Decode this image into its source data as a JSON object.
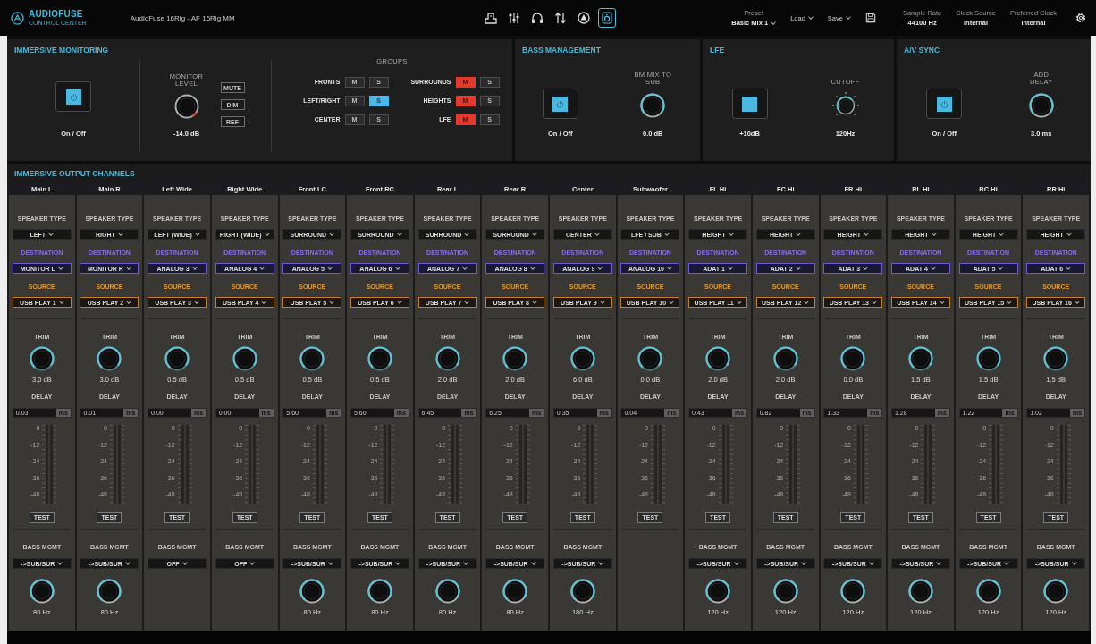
{
  "top_bar": {
    "logo": {
      "name": "AUDIOFUSE",
      "subtitle": "CONTROL CENTER"
    },
    "device": "AudioFuse 16Rig - AF 16Rig MM",
    "view_tabs": [
      {
        "kind": "device",
        "selected": false
      },
      {
        "kind": "mixer",
        "selected": false
      },
      {
        "kind": "headphones",
        "selected": false
      },
      {
        "kind": "routing",
        "selected": false
      },
      {
        "kind": "immersive",
        "selected": false
      },
      {
        "kind": "speaker",
        "selected": true
      }
    ],
    "preset": {
      "label": "Preset",
      "value": "Basic Mix 1"
    },
    "load": "Load",
    "save": "Save",
    "sample_rate": {
      "label": "Sample Rate",
      "value": "44100 Hz"
    },
    "clock_source": {
      "label": "Clock Source",
      "value": "Internal"
    },
    "preferred_clock": {
      "label": "Preferred Clock",
      "value": "Internal"
    }
  },
  "immersive_monitoring": {
    "title": "IMMERSIVE MONITORING",
    "power": {
      "label": "On / Off",
      "on": true
    },
    "monitor_level": {
      "label": "MONITOR LEVEL",
      "value": "-14.0 dB"
    },
    "buttons": [
      {
        "label": "MUTE",
        "on": false
      },
      {
        "label": "DIM",
        "on": false
      },
      {
        "label": "REF",
        "on": false
      }
    ],
    "groups": {
      "title": "GROUPS",
      "items": [
        {
          "label": "FRONTS",
          "buttons": [
            {
              "kind": "mute",
              "label": "M",
              "on": false
            },
            {
              "kind": "solo",
              "label": "S",
              "on": false
            }
          ]
        },
        {
          "label": "SURROUNDS",
          "buttons": [
            {
              "kind": "mute",
              "label": "M",
              "on": true
            },
            {
              "kind": "solo",
              "label": "S",
              "on": false
            }
          ]
        },
        {
          "label": "LEFT/RIGHT",
          "buttons": [
            {
              "kind": "mute",
              "label": "M",
              "on": false
            },
            {
              "kind": "solo",
              "label": "S",
              "on": true
            }
          ]
        },
        {
          "label": "HEIGHTS",
          "buttons": [
            {
              "kind": "mute",
              "label": "M",
              "on": true
            },
            {
              "kind": "solo",
              "label": "S",
              "on": false
            }
          ]
        },
        {
          "label": "CENTER",
          "buttons": [
            {
              "kind": "mute",
              "label": "M",
              "on": false
            },
            {
              "kind": "solo",
              "label": "S",
              "on": false
            }
          ]
        },
        {
          "label": "LFE",
          "buttons": [
            {
              "kind": "mute",
              "label": "M",
              "on": true
            },
            {
              "kind": "solo",
              "label": "S",
              "on": false
            }
          ]
        }
      ]
    }
  },
  "bass_management": {
    "title": "BASS MANAGEMENT",
    "power": {
      "label": "On / Off",
      "on": true
    },
    "mix_to_sub": {
      "label": "BM MIX TO SUB",
      "value": "0.0 dB"
    }
  },
  "lfe": {
    "title": "LFE",
    "boost": {
      "label": "+10dB",
      "on": true
    },
    "cutoff": {
      "label": "CUTOFF",
      "value": "120Hz"
    }
  },
  "av_sync": {
    "title": "A/V SYNC",
    "power": {
      "label": "On / Off",
      "on": true
    },
    "add_delay": {
      "label": "ADD DELAY",
      "value": "3.0 ms"
    }
  },
  "output_channels": {
    "title": "IMMERSIVE OUTPUT CHANNELS",
    "channels": [
      {
        "name": "Main L",
        "speaker_type": {
          "label": "SPEAKER TYPE",
          "value": "LEFT"
        },
        "destination": {
          "label": "DESTINATION",
          "value": "MONITOR L"
        },
        "source": {
          "label": "SOURCE",
          "value": "USB PLAY 1"
        },
        "trim": {
          "label": "TRIM",
          "value": "3.0 dB"
        },
        "delay": {
          "label": "DELAY",
          "value": "0.03",
          "unit": "ms"
        },
        "meter_scale": [
          "0",
          "-12",
          "-24",
          "-36",
          "-48"
        ],
        "test": "TEST",
        "bass_mgmt": {
          "label": "BASS MGMT",
          "value": "->SUB/SUR",
          "crossover": "80 Hz"
        }
      },
      {
        "name": "Main R",
        "speaker_type": {
          "label": "SPEAKER TYPE",
          "value": "RIGHT"
        },
        "destination": {
          "label": "DESTINATION",
          "value": "MONITOR R"
        },
        "source": {
          "label": "SOURCE",
          "value": "USB PLAY 2"
        },
        "trim": {
          "label": "TRIM",
          "value": "3.0 dB"
        },
        "delay": {
          "label": "DELAY",
          "value": "0.01",
          "unit": "ms"
        },
        "meter_scale": [
          "0",
          "-12",
          "-24",
          "-36",
          "-48"
        ],
        "test": "TEST",
        "bass_mgmt": {
          "label": "BASS MGMT",
          "value": "->SUB/SUR",
          "crossover": "80 Hz"
        }
      },
      {
        "name": "Left Wide",
        "speaker_type": {
          "label": "SPEAKER TYPE",
          "value": "LEFT (WIDE)"
        },
        "destination": {
          "label": "DESTINATION",
          "value": "ANALOG 3"
        },
        "source": {
          "label": "SOURCE",
          "value": "USB PLAY 3"
        },
        "trim": {
          "label": "TRIM",
          "value": "0.5 dB"
        },
        "delay": {
          "label": "DELAY",
          "value": "0.00",
          "unit": "ms"
        },
        "meter_scale": [
          "0",
          "-12",
          "-24",
          "-36",
          "-48"
        ],
        "test": "TEST",
        "bass_mgmt": {
          "label": "BASS MGMT",
          "value": "OFF"
        }
      },
      {
        "name": "Right Wide",
        "speaker_type": {
          "label": "SPEAKER TYPE",
          "value": "RIGHT (WIDE)"
        },
        "destination": {
          "label": "DESTINATION",
          "value": "ANALOG 4"
        },
        "source": {
          "label": "SOURCE",
          "value": "USB PLAY 4"
        },
        "trim": {
          "label": "TRIM",
          "value": "0.5 dB"
        },
        "delay": {
          "label": "DELAY",
          "value": "0.00",
          "unit": "ms"
        },
        "meter_scale": [
          "0",
          "-12",
          "-24",
          "-36",
          "-48"
        ],
        "test": "TEST",
        "bass_mgmt": {
          "label": "BASS MGMT",
          "value": "OFF"
        }
      },
      {
        "name": "Front LC",
        "speaker_type": {
          "label": "SPEAKER TYPE",
          "value": "SURROUND"
        },
        "destination": {
          "label": "DESTINATION",
          "value": "ANALOG 5"
        },
        "source": {
          "label": "SOURCE",
          "value": "USB PLAY 5"
        },
        "trim": {
          "label": "TRIM",
          "value": "0.5 dB"
        },
        "delay": {
          "label": "DELAY",
          "value": "5.60",
          "unit": "ms"
        },
        "meter_scale": [
          "0",
          "-12",
          "-24",
          "-36",
          "-48"
        ],
        "test": "TEST",
        "bass_mgmt": {
          "label": "BASS MGMT",
          "value": "->SUB/SUR",
          "crossover": "80 Hz"
        }
      },
      {
        "name": "Front RC",
        "speaker_type": {
          "label": "SPEAKER TYPE",
          "value": "SURROUND"
        },
        "destination": {
          "label": "DESTINATION",
          "value": "ANALOG 6"
        },
        "source": {
          "label": "SOURCE",
          "value": "USB PLAY 6"
        },
        "trim": {
          "label": "TRIM",
          "value": "0.5 dB"
        },
        "delay": {
          "label": "DELAY",
          "value": "5.60",
          "unit": "ms"
        },
        "meter_scale": [
          "0",
          "-12",
          "-24",
          "-36",
          "-48"
        ],
        "test": "TEST",
        "bass_mgmt": {
          "label": "BASS MGMT",
          "value": "->SUB/SUR",
          "crossover": "80 Hz"
        }
      },
      {
        "name": "Rear L",
        "speaker_type": {
          "label": "SPEAKER TYPE",
          "value": "SURROUND"
        },
        "destination": {
          "label": "DESTINATION",
          "value": "ANALOG 7"
        },
        "source": {
          "label": "SOURCE",
          "value": "USB PLAY 7"
        },
        "trim": {
          "label": "TRIM",
          "value": "2.0 dB"
        },
        "delay": {
          "label": "DELAY",
          "value": "6.45",
          "unit": "ms"
        },
        "meter_scale": [
          "0",
          "-12",
          "-24",
          "-36",
          "-48"
        ],
        "test": "TEST",
        "bass_mgmt": {
          "label": "BASS MGMT",
          "value": "->SUB/SUR",
          "crossover": "80 Hz"
        }
      },
      {
        "name": "Rear R",
        "speaker_type": {
          "label": "SPEAKER TYPE",
          "value": "SURROUND"
        },
        "destination": {
          "label": "DESTINATION",
          "value": "ANALOG 8"
        },
        "source": {
          "label": "SOURCE",
          "value": "USB PLAY 8"
        },
        "trim": {
          "label": "TRIM",
          "value": "2.0 dB"
        },
        "delay": {
          "label": "DELAY",
          "value": "6.25",
          "unit": "ms"
        },
        "meter_scale": [
          "0",
          "-12",
          "-24",
          "-36",
          "-48"
        ],
        "test": "TEST",
        "bass_mgmt": {
          "label": "BASS MGMT",
          "value": "->SUB/SUR",
          "crossover": "80 Hz"
        }
      },
      {
        "name": "Center",
        "speaker_type": {
          "label": "SPEAKER TYPE",
          "value": "CENTER"
        },
        "destination": {
          "label": "DESTINATION",
          "value": "ANALOG 9"
        },
        "source": {
          "label": "SOURCE",
          "value": "USB PLAY 9"
        },
        "trim": {
          "label": "TRIM",
          "value": "6.0 dB"
        },
        "delay": {
          "label": "DELAY",
          "value": "0.35",
          "unit": "ms"
        },
        "meter_scale": [
          "0",
          "-12",
          "-24",
          "-36",
          "-48"
        ],
        "test": "TEST",
        "bass_mgmt": {
          "label": "BASS MGMT",
          "value": "->SUB/SUR",
          "crossover": "180 Hz"
        }
      },
      {
        "name": "Subwoofer",
        "speaker_type": {
          "label": "SPEAKER TYPE",
          "value": "LFE / SUB"
        },
        "destination": {
          "label": "DESTINATION",
          "value": "ANALOG 10"
        },
        "source": {
          "label": "SOURCE",
          "value": "USB PLAY 10"
        },
        "trim": {
          "label": "TRIM",
          "value": "0.0 dB"
        },
        "delay": {
          "label": "DELAY",
          "value": "0.04",
          "unit": "ms"
        },
        "meter_scale": [
          "0",
          "-12",
          "-24",
          "-36",
          "-48"
        ],
        "test": "TEST"
      },
      {
        "name": "FL Hi",
        "speaker_type": {
          "label": "SPEAKER TYPE",
          "value": "HEIGHT"
        },
        "destination": {
          "label": "DESTINATION",
          "value": "ADAT 1"
        },
        "source": {
          "label": "SOURCE",
          "value": "USB PLAY 11"
        },
        "trim": {
          "label": "TRIM",
          "value": "2.0 dB"
        },
        "delay": {
          "label": "DELAY",
          "value": "0.43",
          "unit": "ms"
        },
        "meter_scale": [
          "0",
          "-12",
          "-24",
          "-36",
          "-48"
        ],
        "test": "TEST",
        "bass_mgmt": {
          "label": "BASS MGMT",
          "value": "->SUB/SUR",
          "crossover": "120 Hz"
        }
      },
      {
        "name": "FC Hi",
        "speaker_type": {
          "label": "SPEAKER TYPE",
          "value": "HEIGHT"
        },
        "destination": {
          "label": "DESTINATION",
          "value": "ADAT 2"
        },
        "source": {
          "label": "SOURCE",
          "value": "USB PLAY 12"
        },
        "trim": {
          "label": "TRIM",
          "value": "2.0 dB"
        },
        "delay": {
          "label": "DELAY",
          "value": "0.82",
          "unit": "ms"
        },
        "meter_scale": [
          "0",
          "-12",
          "-24",
          "-36",
          "-48"
        ],
        "test": "TEST",
        "bass_mgmt": {
          "label": "BASS MGMT",
          "value": "->SUB/SUR",
          "crossover": "120 Hz"
        }
      },
      {
        "name": "FR Hi",
        "speaker_type": {
          "label": "SPEAKER TYPE",
          "value": "HEIGHT"
        },
        "destination": {
          "label": "DESTINATION",
          "value": "ADAT 3"
        },
        "source": {
          "label": "SOURCE",
          "value": "USB PLAY 13"
        },
        "trim": {
          "label": "TRIM",
          "value": "0.0 dB"
        },
        "delay": {
          "label": "DELAY",
          "value": "1.33",
          "unit": "ms"
        },
        "meter_scale": [
          "0",
          "-12",
          "-24",
          "-36",
          "-48"
        ],
        "test": "TEST",
        "bass_mgmt": {
          "label": "BASS MGMT",
          "value": "->SUB/SUR",
          "crossover": "120 Hz"
        }
      },
      {
        "name": "RL Hi",
        "speaker_type": {
          "label": "SPEAKER TYPE",
          "value": "HEIGHT"
        },
        "destination": {
          "label": "DESTINATION",
          "value": "ADAT 4"
        },
        "source": {
          "label": "SOURCE",
          "value": "USB PLAY 14"
        },
        "trim": {
          "label": "TRIM",
          "value": "1.5 dB"
        },
        "delay": {
          "label": "DELAY",
          "value": "1.28",
          "unit": "ms"
        },
        "meter_scale": [
          "0",
          "-12",
          "-24",
          "-36",
          "-48"
        ],
        "test": "TEST",
        "bass_mgmt": {
          "label": "BASS MGMT",
          "value": "->SUB/SUR",
          "crossover": "120 Hz"
        }
      },
      {
        "name": "RC Hi",
        "speaker_type": {
          "label": "SPEAKER TYPE",
          "value": "HEIGHT"
        },
        "destination": {
          "label": "DESTINATION",
          "value": "ADAT 5"
        },
        "source": {
          "label": "SOURCE",
          "value": "USB PLAY 15"
        },
        "trim": {
          "label": "TRIM",
          "value": "1.5 dB"
        },
        "delay": {
          "label": "DELAY",
          "value": "1.22",
          "unit": "ms"
        },
        "meter_scale": [
          "0",
          "-12",
          "-24",
          "-36",
          "-48"
        ],
        "test": "TEST",
        "bass_mgmt": {
          "label": "BASS MGMT",
          "value": "->SUB/SUR",
          "crossover": "120 Hz"
        }
      },
      {
        "name": "RR Hi",
        "speaker_type": {
          "label": "SPEAKER TYPE",
          "value": "HEIGHT"
        },
        "destination": {
          "label": "DESTINATION",
          "value": "ADAT 6"
        },
        "source": {
          "label": "SOURCE",
          "value": "USB PLAY 16"
        },
        "trim": {
          "label": "TRIM",
          "value": "1.5 dB"
        },
        "delay": {
          "label": "DELAY",
          "value": "1.02",
          "unit": "ms"
        },
        "meter_scale": [
          "0",
          "-12",
          "-24",
          "-36",
          "-48"
        ],
        "test": "TEST",
        "bass_mgmt": {
          "label": "BASS MGMT",
          "value": "->SUB/SUR",
          "crossover": "120 Hz"
        }
      }
    ]
  }
}
